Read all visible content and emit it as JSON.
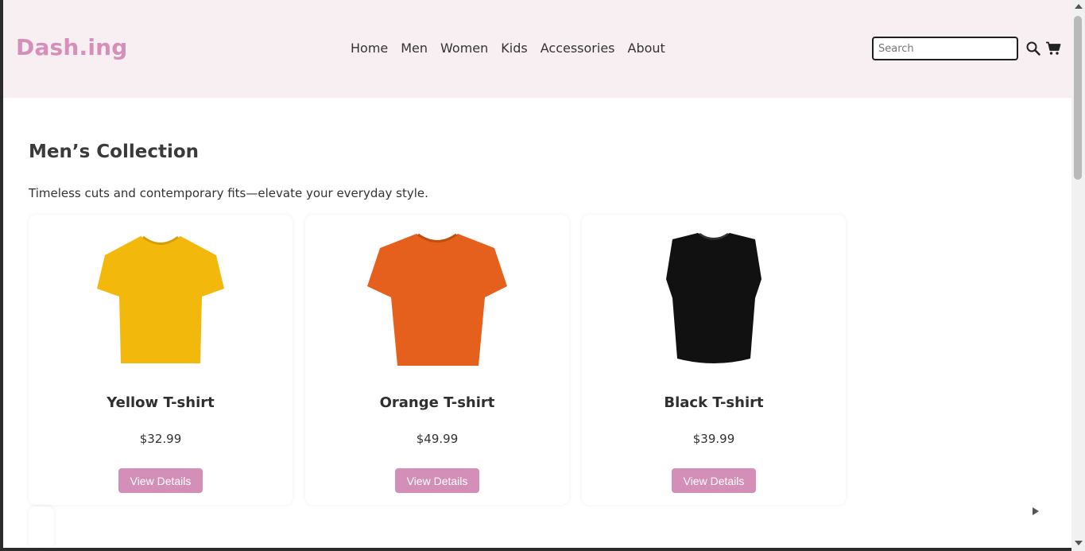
{
  "header": {
    "logo": "Dash.ing",
    "nav": [
      "Home",
      "Men",
      "Women",
      "Kids",
      "Accessories",
      "About"
    ],
    "search_placeholder": "Search",
    "icons": {
      "search": "search-icon",
      "cart": "cart-icon"
    }
  },
  "main": {
    "title": "Men’s Collection",
    "subtitle": "Timeless cuts and contemporary fits—elevate your everyday style.",
    "products": [
      {
        "name": "Yellow T-shirt",
        "price": "$32.99",
        "button": "View Details",
        "color": "#f2b90c"
      },
      {
        "name": "Orange T-shirt",
        "price": "$49.99",
        "button": "View Details",
        "color": "#e4601c"
      },
      {
        "name": "Black T-shirt",
        "price": "$39.99",
        "button": "View Details",
        "color": "#111111"
      }
    ]
  },
  "colors": {
    "brand": "#d68fb9",
    "header_bg": "#f8eff3",
    "button_bg": "#d48fb8"
  }
}
